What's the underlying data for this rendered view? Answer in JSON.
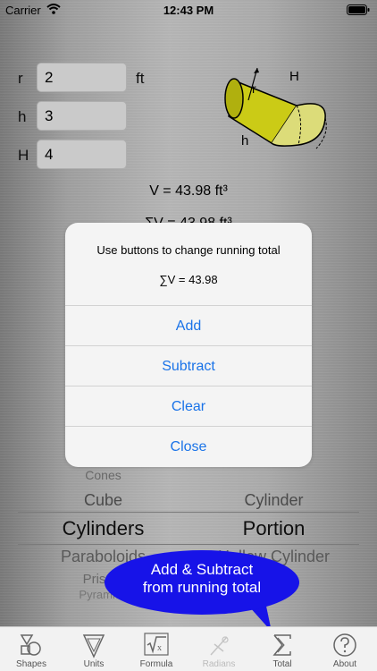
{
  "status_bar": {
    "carrier": "Carrier",
    "time": "12:43 PM"
  },
  "inputs": [
    {
      "label": "r",
      "value": "2"
    },
    {
      "label": "h",
      "value": "3"
    },
    {
      "label": "H",
      "value": "4"
    }
  ],
  "unit": "ft",
  "figure_labels": {
    "r": "r",
    "H": "H",
    "h": "h"
  },
  "results": {
    "volume": "V = 43.98 ft³",
    "partial": "ΣV = 43.98 ft³"
  },
  "alert": {
    "message": "Use buttons to change running total",
    "total": "∑V = 43.98",
    "buttons": [
      "Add",
      "Subtract",
      "Clear",
      "Close"
    ]
  },
  "picker": {
    "left": [
      "Cones",
      "Cube",
      "Cylinders",
      "Paraboloids",
      "Prisms",
      "Pyramids"
    ],
    "right": [
      "",
      "Cylinder",
      "Portion",
      "Hollow Cylinder",
      "",
      ""
    ]
  },
  "bubble": {
    "line1": "Add & Subtract",
    "line2": "from running total"
  },
  "tabs": [
    {
      "label": "Shapes",
      "icon": "shapes-icon"
    },
    {
      "label": "Units",
      "icon": "units-icon"
    },
    {
      "label": "Formula",
      "icon": "formula-icon"
    },
    {
      "label": "Radians",
      "icon": "radians-icon"
    },
    {
      "label": "Total",
      "icon": "sigma-icon"
    },
    {
      "label": "About",
      "icon": "question-icon"
    }
  ],
  "colors": {
    "accent": "#1a73e8",
    "bubble": "#1713e8",
    "cylinder": "#e6e619"
  }
}
